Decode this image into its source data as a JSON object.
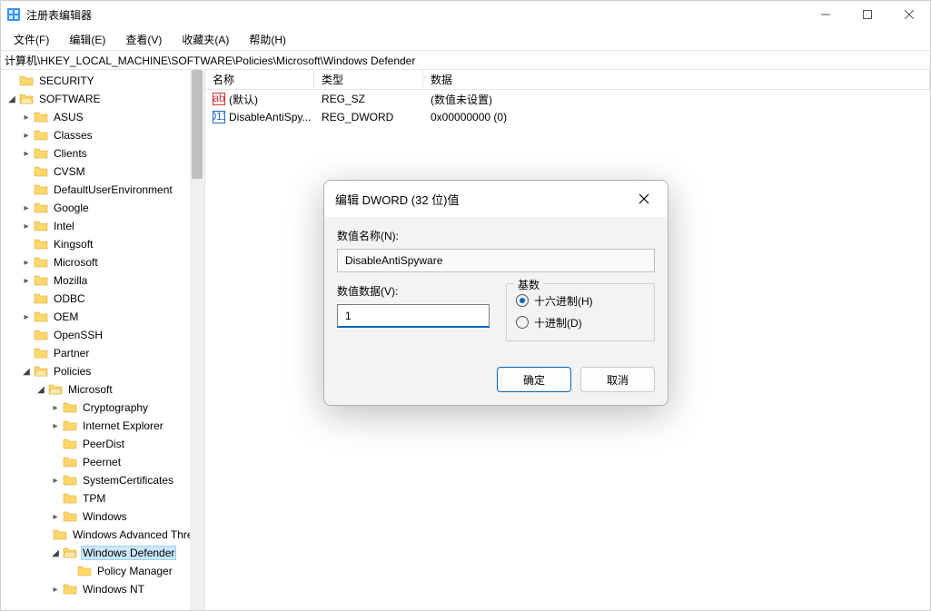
{
  "window": {
    "title": "注册表编辑器"
  },
  "menu": [
    "文件(F)",
    "编辑(E)",
    "查看(V)",
    "收藏夹(A)",
    "帮助(H)"
  ],
  "address": "计算机\\HKEY_LOCAL_MACHINE\\SOFTWARE\\Policies\\Microsoft\\Windows Defender",
  "tree": [
    {
      "label": "SECURITY",
      "depth": 0,
      "chev": "blank"
    },
    {
      "label": "SOFTWARE",
      "depth": 0,
      "chev": "open"
    },
    {
      "label": "ASUS",
      "depth": 1,
      "chev": "closed"
    },
    {
      "label": "Classes",
      "depth": 1,
      "chev": "closed"
    },
    {
      "label": "Clients",
      "depth": 1,
      "chev": "closed"
    },
    {
      "label": "CVSM",
      "depth": 1,
      "chev": "blank"
    },
    {
      "label": "DefaultUserEnvironment",
      "depth": 1,
      "chev": "blank"
    },
    {
      "label": "Google",
      "depth": 1,
      "chev": "closed"
    },
    {
      "label": "Intel",
      "depth": 1,
      "chev": "closed"
    },
    {
      "label": "Kingsoft",
      "depth": 1,
      "chev": "blank"
    },
    {
      "label": "Microsoft",
      "depth": 1,
      "chev": "closed"
    },
    {
      "label": "Mozilla",
      "depth": 1,
      "chev": "closed"
    },
    {
      "label": "ODBC",
      "depth": 1,
      "chev": "blank"
    },
    {
      "label": "OEM",
      "depth": 1,
      "chev": "closed"
    },
    {
      "label": "OpenSSH",
      "depth": 1,
      "chev": "blank"
    },
    {
      "label": "Partner",
      "depth": 1,
      "chev": "blank"
    },
    {
      "label": "Policies",
      "depth": 1,
      "chev": "open"
    },
    {
      "label": "Microsoft",
      "depth": 2,
      "chev": "open"
    },
    {
      "label": "Cryptography",
      "depth": 3,
      "chev": "closed"
    },
    {
      "label": "Internet Explorer",
      "depth": 3,
      "chev": "closed"
    },
    {
      "label": "PeerDist",
      "depth": 3,
      "chev": "blank"
    },
    {
      "label": "Peernet",
      "depth": 3,
      "chev": "blank"
    },
    {
      "label": "SystemCertificates",
      "depth": 3,
      "chev": "closed"
    },
    {
      "label": "TPM",
      "depth": 3,
      "chev": "blank"
    },
    {
      "label": "Windows",
      "depth": 3,
      "chev": "closed"
    },
    {
      "label": "Windows Advanced Threat Protection",
      "depth": 3,
      "chev": "blank"
    },
    {
      "label": "Windows Defender",
      "depth": 3,
      "chev": "open",
      "selected": true
    },
    {
      "label": "Policy Manager",
      "depth": 4,
      "chev": "blank"
    },
    {
      "label": "Windows NT",
      "depth": 3,
      "chev": "closed"
    }
  ],
  "columns": {
    "name": "名称",
    "type": "类型",
    "data": "数据"
  },
  "values": [
    {
      "name": "(默认)",
      "type": "REG_SZ",
      "data": "(数值未设置)",
      "kind": "sz"
    },
    {
      "name": "DisableAntiSpy...",
      "type": "REG_DWORD",
      "data": "0x00000000 (0)",
      "kind": "dw"
    }
  ],
  "dialog": {
    "title": "编辑 DWORD (32 位)值",
    "name_label": "数值名称(N):",
    "name_value": "DisableAntiSpyware",
    "data_label": "数值数据(V):",
    "data_value": "1",
    "base_label": "基数",
    "radio_hex": "十六进制(H)",
    "radio_dec": "十进制(D)",
    "ok": "确定",
    "cancel": "取消"
  }
}
